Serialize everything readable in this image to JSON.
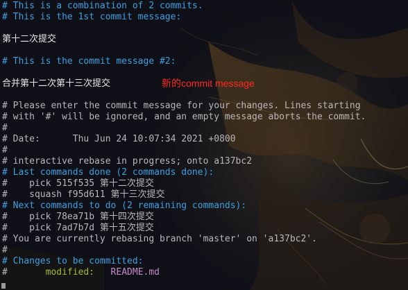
{
  "editor": {
    "lines": {
      "l1": "# This is a combination of 2 commits.",
      "l2": "# This is the 1st commit message:",
      "l3": "第十二次提交",
      "l4": "# This is the commit message #2:",
      "l5": "合并第十二次第十三次提交",
      "l6": "# Please enter the commit message for your changes. Lines starting",
      "l7": "# with '#' will be ignored, and an empty message aborts the commit.",
      "l8": "#",
      "l9": "# Date:      Thu Jun 24 10:07:34 2021 +0800",
      "l10": "#",
      "l11": "# interactive rebase in progress; onto a137bc2",
      "l12": "# Last commands done (2 commands done):",
      "l13": "#    pick 515f535 第十二次提交",
      "l14": "#    squash f95d611 第十三次提交",
      "l15": "# Next commands to do (2 remaining commands):",
      "l16": "#    pick 78ea71b 第十四次提交",
      "l17": "#    pick 7ad7b7d 第十五次提交",
      "l18": "# You are currently rebasing branch 'master' on 'a137bc2'.",
      "l19": "#",
      "l20": "# Changes to be committed:",
      "l21_prefix": "#       ",
      "l21_status": "modified:",
      "l21_file": "   README.md"
    },
    "annotation": "新的commit message"
  },
  "colors": {
    "comment_blue": "#3b9fe0",
    "comment_gray": "#b8b8b8",
    "text_white": "#e6e6e6",
    "status_green": "#a8b826",
    "file_purple": "#c48ac8",
    "annotation_red": "#ff2a1f"
  }
}
